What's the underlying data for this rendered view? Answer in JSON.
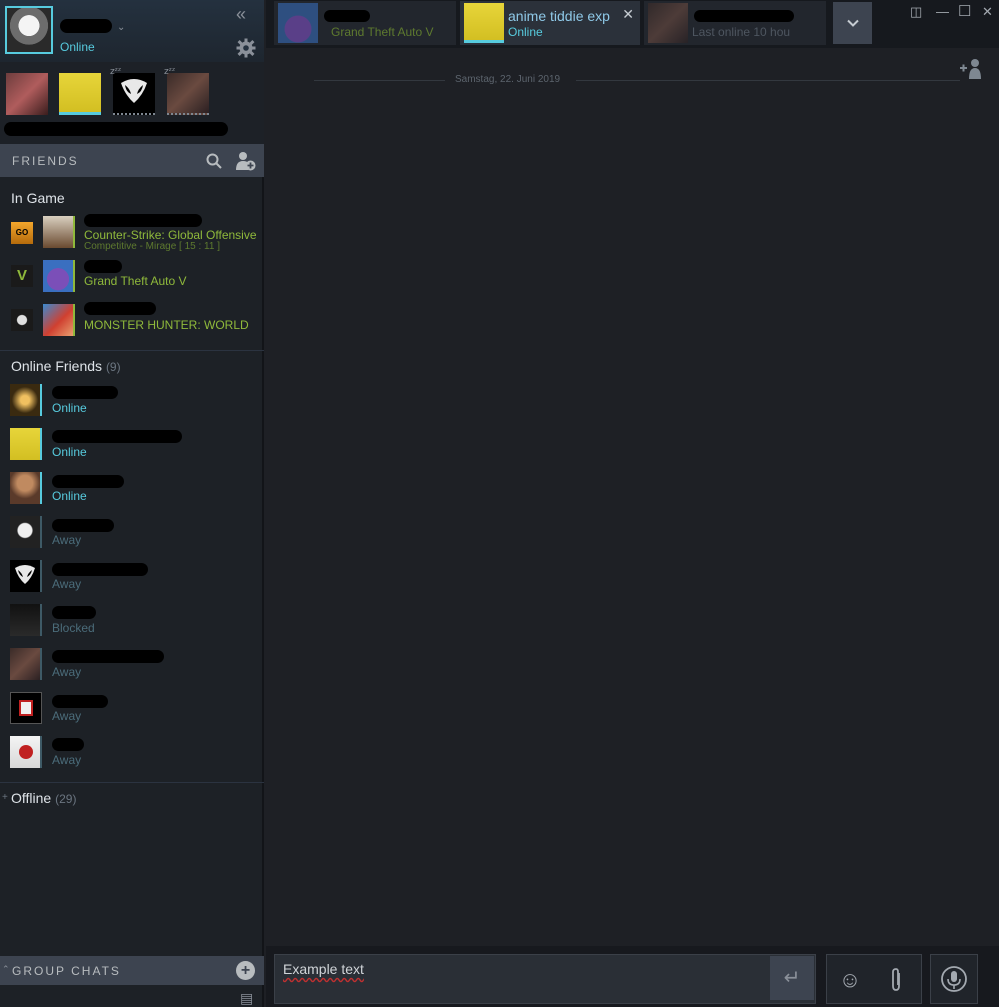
{
  "user": {
    "status": "Online"
  },
  "friends_header": {
    "label": "FRIENDS"
  },
  "in_game": {
    "title": "In Game",
    "items": [
      {
        "game": "Counter-Strike: Global Offensive",
        "rich_presence": "Competitive - Mirage [ 15 : 11 ]"
      },
      {
        "game": "Grand Theft Auto V"
      },
      {
        "game": "MONSTER HUNTER: WORLD"
      }
    ]
  },
  "online_friends": {
    "title": "Online Friends",
    "count": "(9)",
    "items": [
      {
        "status": "Online",
        "type": "online"
      },
      {
        "status": "Online",
        "type": "online"
      },
      {
        "status": "Online",
        "type": "online"
      },
      {
        "status": "Away",
        "type": "away"
      },
      {
        "status": "Away",
        "type": "away"
      },
      {
        "status": "Blocked",
        "type": "away"
      },
      {
        "status": "Away",
        "type": "away"
      },
      {
        "status": "Away",
        "type": "away"
      },
      {
        "status": "Away",
        "type": "away"
      }
    ]
  },
  "offline": {
    "title": "Offline",
    "count": "(29)"
  },
  "group_chats": {
    "label": "GROUP CHATS"
  },
  "tabs": [
    {
      "subtitle": "Grand Theft Auto V",
      "active": false
    },
    {
      "name": "anime tiddie exp",
      "subtitle": "Online",
      "active": true
    },
    {
      "subtitle": "Last online 10 hou",
      "active": false
    }
  ],
  "chat": {
    "date_divider": "Samstag, 22. Juni 2019",
    "entry_text": "Example text"
  },
  "colors": {
    "online": "#57cbde",
    "in_game": "#8fb93b",
    "away": "#4b6c7a",
    "panel_header": "#3d4450"
  },
  "icons": {
    "collapse": "«",
    "chevron": "⌄",
    "send": "↵",
    "emoji": "☺",
    "more": "⌄"
  }
}
